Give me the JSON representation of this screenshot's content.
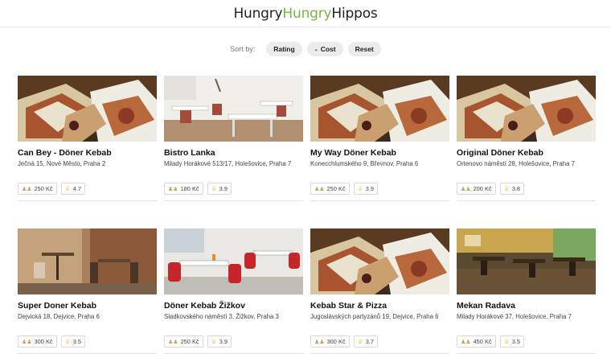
{
  "header": {
    "logo_part1": "Hungry",
    "logo_part2": "Hungry",
    "logo_part3": "Hippos"
  },
  "sortbar": {
    "label": "Sort by:",
    "rating": "Rating",
    "cost": "Cost",
    "reset": "Reset"
  },
  "colors": {
    "accent": "#7bb342",
    "chip_bg": "#ececec",
    "star": "#e0b53a"
  },
  "restaurants": [
    {
      "name": "Can Bey - Döner Kebab",
      "address": "Ječná 15, Nové Město, Praha 2",
      "price": "250 Kč",
      "rating": "4.7",
      "image": "kebab-photo"
    },
    {
      "name": "Bistro Lanka",
      "address": "Milady Horákové 513/17, Holešovice, Praha 7",
      "price": "180 Kč",
      "rating": "3.9",
      "image": "white-dining-room-photo"
    },
    {
      "name": "My Way Döner Kebab",
      "address": "Konecchlumského 9, Břevnov, Praha 6",
      "price": "250 Kč",
      "rating": "3.9",
      "image": "kebab-photo"
    },
    {
      "name": "Original Döner Kebab",
      "address": "Ortenovo náměstí 28, Holešovice, Praha 7",
      "price": "200 Kč",
      "rating": "3.8",
      "image": "kebab-photo"
    },
    {
      "name": "Super Doner Kebab",
      "address": "Dejvická 18, Dejvice, Praha 6",
      "price": "300 Kč",
      "rating": "3.5",
      "image": "brick-interior-photo"
    },
    {
      "name": "Döner Kebab Žižkov",
      "address": "Sladkovského náměstí 3, Žižkov, Praha 3",
      "price": "250 Kč",
      "rating": "3.9",
      "image": "red-chairs-photo"
    },
    {
      "name": "Kebab Star & Pizza",
      "address": "Jugoslávských partyzánů 19, Dejvice, Praha 6",
      "price": "300 Kč",
      "rating": "3.7",
      "image": "kebab-photo"
    },
    {
      "name": "Mekan Radava",
      "address": "Milady Horákové 37, Holešovice, Praha 7",
      "price": "450 Kč",
      "rating": "3.5",
      "image": "restaurant-interior-photo"
    }
  ]
}
